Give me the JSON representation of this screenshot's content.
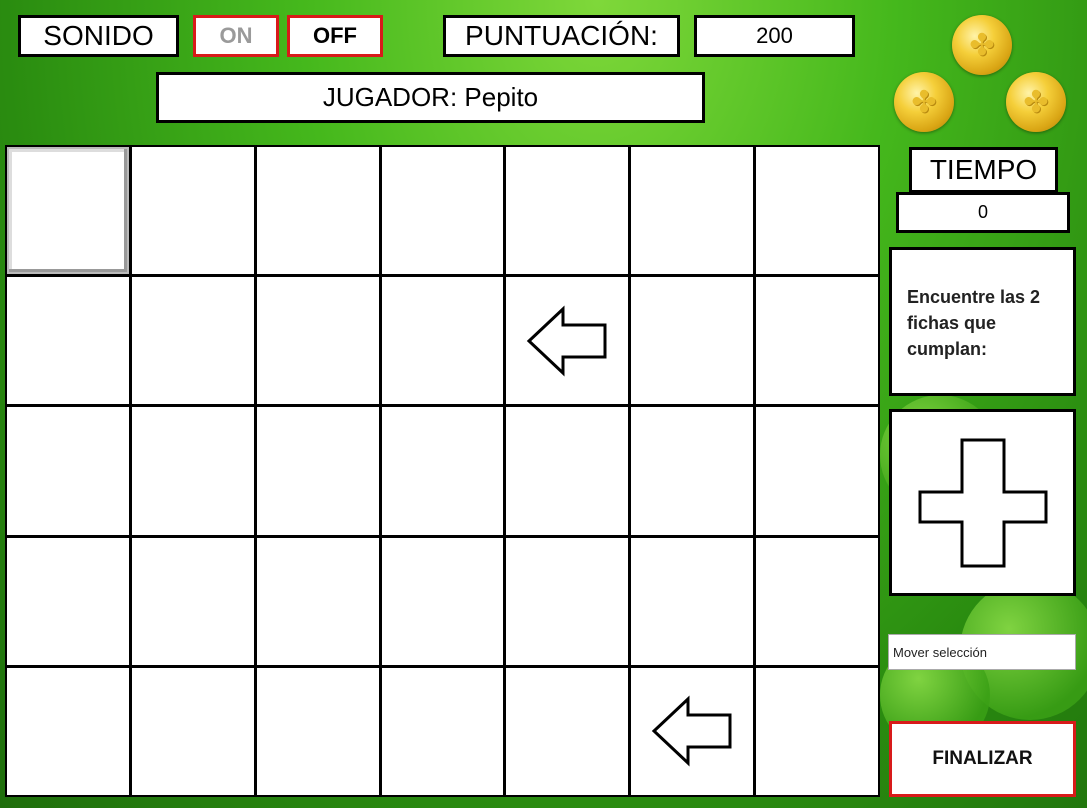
{
  "sound": {
    "label": "SONIDO",
    "on_label": "ON",
    "off_label": "OFF"
  },
  "score": {
    "label": "PUNTUACIÓN:",
    "value": "200"
  },
  "player": {
    "label": "JUGADOR: Pepito"
  },
  "timer": {
    "label": "TIEMPO",
    "value": "0"
  },
  "instructions": {
    "text": "Encuentre las 2 fichas que cumplan:"
  },
  "target_symbol": "cross-icon",
  "move_selection": {
    "label": "Mover selección"
  },
  "finish_button": {
    "label": "FINALIZAR"
  },
  "board": {
    "rows": 5,
    "cols": 7,
    "selected_cell": [
      0,
      0
    ],
    "tiles": [
      {
        "row": 1,
        "col": 4,
        "symbol": "left-arrow-icon"
      },
      {
        "row": 4,
        "col": 5,
        "symbol": "left-arrow-icon"
      }
    ]
  },
  "colors": {
    "accent_red": "#d81a1a",
    "background_green": "#45b81c",
    "coin_gold": "#f5cf3a"
  }
}
